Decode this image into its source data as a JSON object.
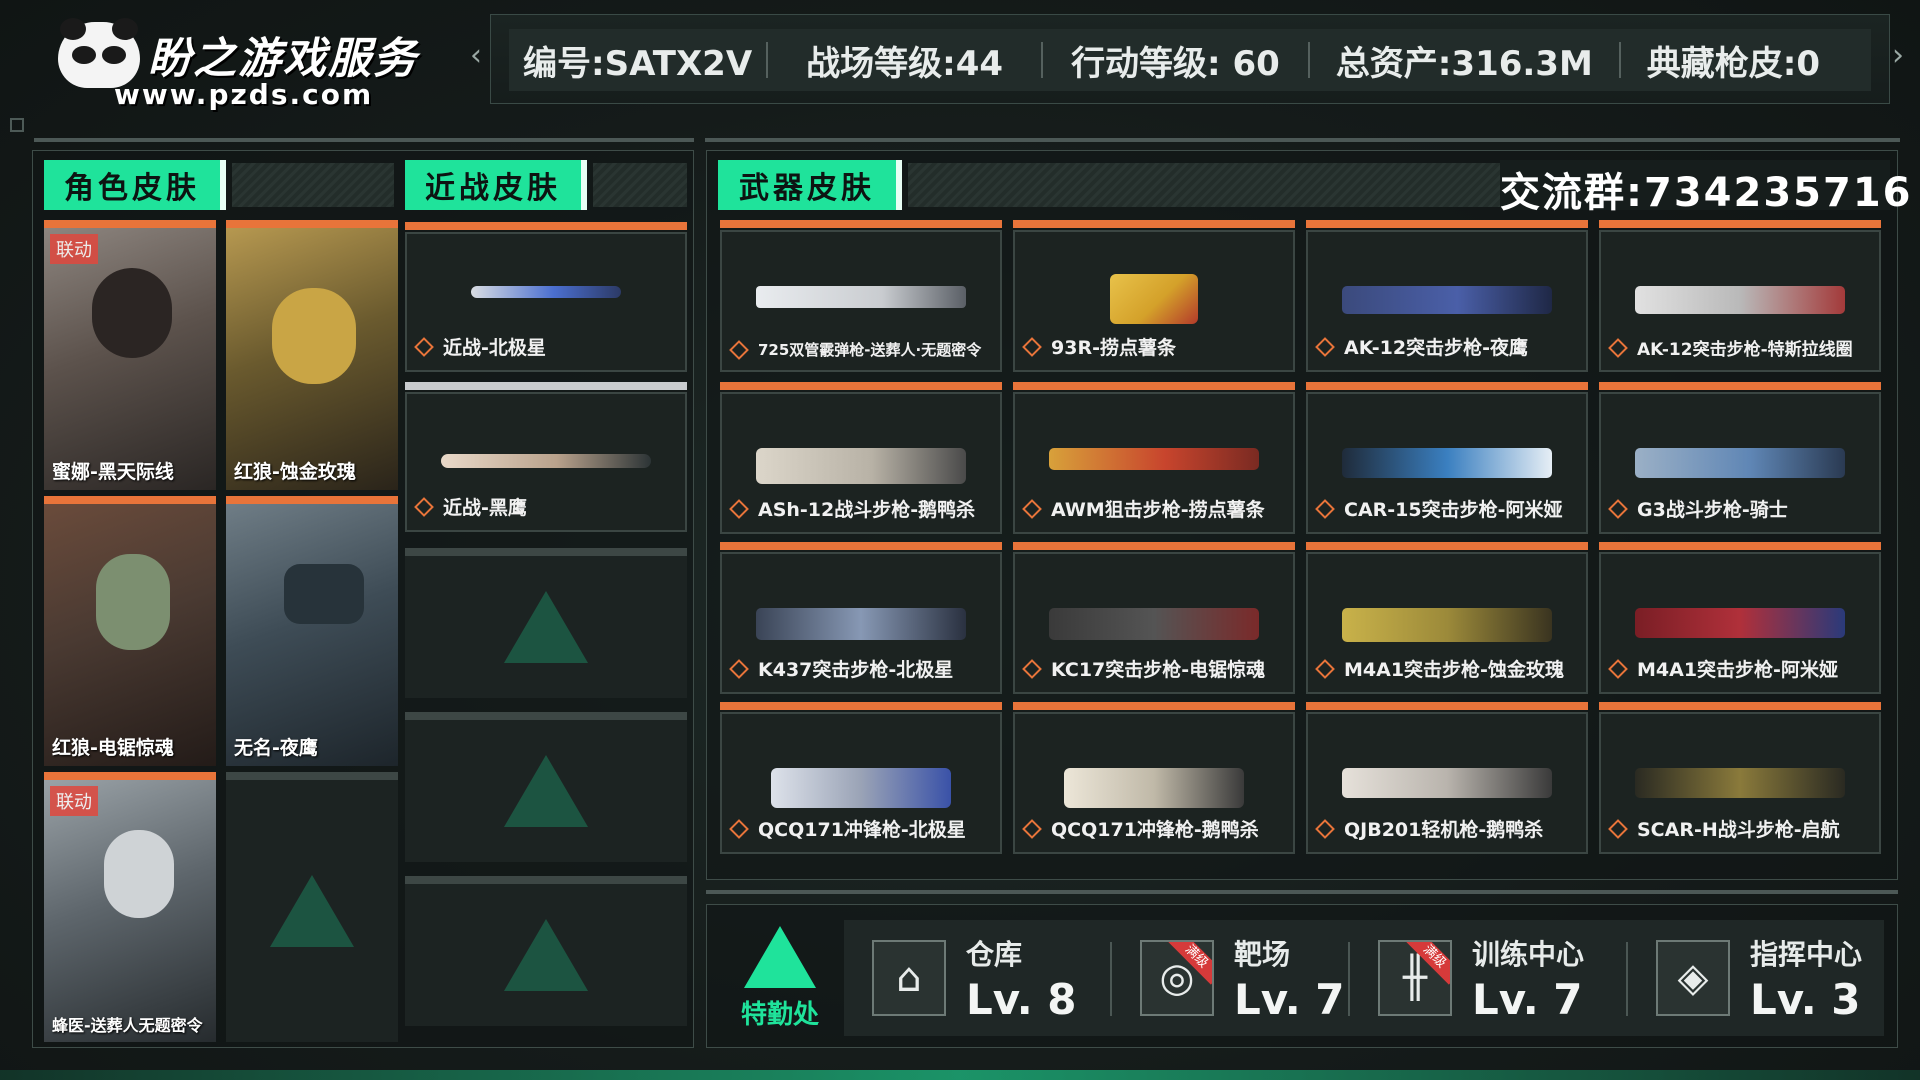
{
  "header": {
    "logo_title": "盼之游戏服务",
    "logo_url": "www.pzds.com",
    "info": [
      "编号:SATX2V",
      "战场等级:44",
      "行动等级: 60",
      "总资产:316.3M",
      "典藏枪皮:0"
    ],
    "prev_arrow": "‹",
    "next_arrow": "›"
  },
  "sections": {
    "character": "角色皮肤",
    "melee": "近战皮肤",
    "weapon": "武器皮肤"
  },
  "group_label": "交流群:734235716",
  "characters": [
    {
      "label": "蜜娜-黑天际线",
      "badge": "联动",
      "color": "#6c5f57"
    },
    {
      "label": "红狼-蚀金玫瑰",
      "badge": "",
      "color": "#6b5a2f"
    },
    {
      "label": "红狼-电锯惊魂",
      "badge": "",
      "color": "#4a3a32"
    },
    {
      "label": "无名-夜鹰",
      "badge": "",
      "color": "#3e4c56"
    },
    {
      "label": "蜂医-送葬人无题密令",
      "badge": "联动",
      "color": "#5e666c"
    }
  ],
  "melee": [
    {
      "label": "近战-北极星"
    },
    {
      "label": "近战-黑鹰"
    }
  ],
  "weapons": [
    {
      "label": "725双管霰弹枪-送葬人·无题密令",
      "color": "#c9ccd0"
    },
    {
      "label": "93R-捞点薯条",
      "color": "#d4a12a"
    },
    {
      "label": "AK-12突击步枪-夜鹰",
      "color": "#4a5fa8"
    },
    {
      "label": "AK-12突击步枪-特斯拉线圈",
      "color": "#b9b9b9"
    },
    {
      "label": "ASh-12战斗步枪-鹅鸭杀",
      "color": "#b8b2a6"
    },
    {
      "label": "AWM狙击步枪-捞点薯条",
      "color": "#c8452d"
    },
    {
      "label": "CAR-15突击步枪-阿米娅",
      "color": "#3a7fc0"
    },
    {
      "label": "G3战斗步枪-骑士",
      "color": "#5f86b5"
    },
    {
      "label": "K437突击步枪-北极星",
      "color": "#8798b4"
    },
    {
      "label": "KC17突击步枪-电锯惊魂",
      "color": "#545454"
    },
    {
      "label": "M4A1突击步枪-蚀金玫瑰",
      "color": "#9c8a3a"
    },
    {
      "label": "M4A1突击步枪-阿米娅",
      "color": "#b0303a"
    },
    {
      "label": "QCQ171冲锋枪-北极星",
      "color": "#9aa3b6"
    },
    {
      "label": "QCQ171冲锋枪-鹅鸭杀",
      "color": "#c0b9a8"
    },
    {
      "label": "QJB201轻机枪-鹅鸭杀",
      "color": "#b9b4ad"
    },
    {
      "label": "SCAR-H战斗步枪-启航",
      "color": "#8a7a3b"
    }
  ],
  "logistics": {
    "label": "特勤处"
  },
  "facilities": [
    {
      "name": "仓库",
      "level": "Lv. 8",
      "icon": "warehouse-icon",
      "badge": ""
    },
    {
      "name": "靶场",
      "level": "Lv. 7",
      "icon": "target-icon",
      "badge": "满级"
    },
    {
      "name": "训练中心",
      "level": "Lv. 7",
      "icon": "dumbbell-icon",
      "badge": "满级"
    },
    {
      "name": "指挥中心",
      "level": "Lv. 3",
      "icon": "command-icon",
      "badge": ""
    }
  ]
}
